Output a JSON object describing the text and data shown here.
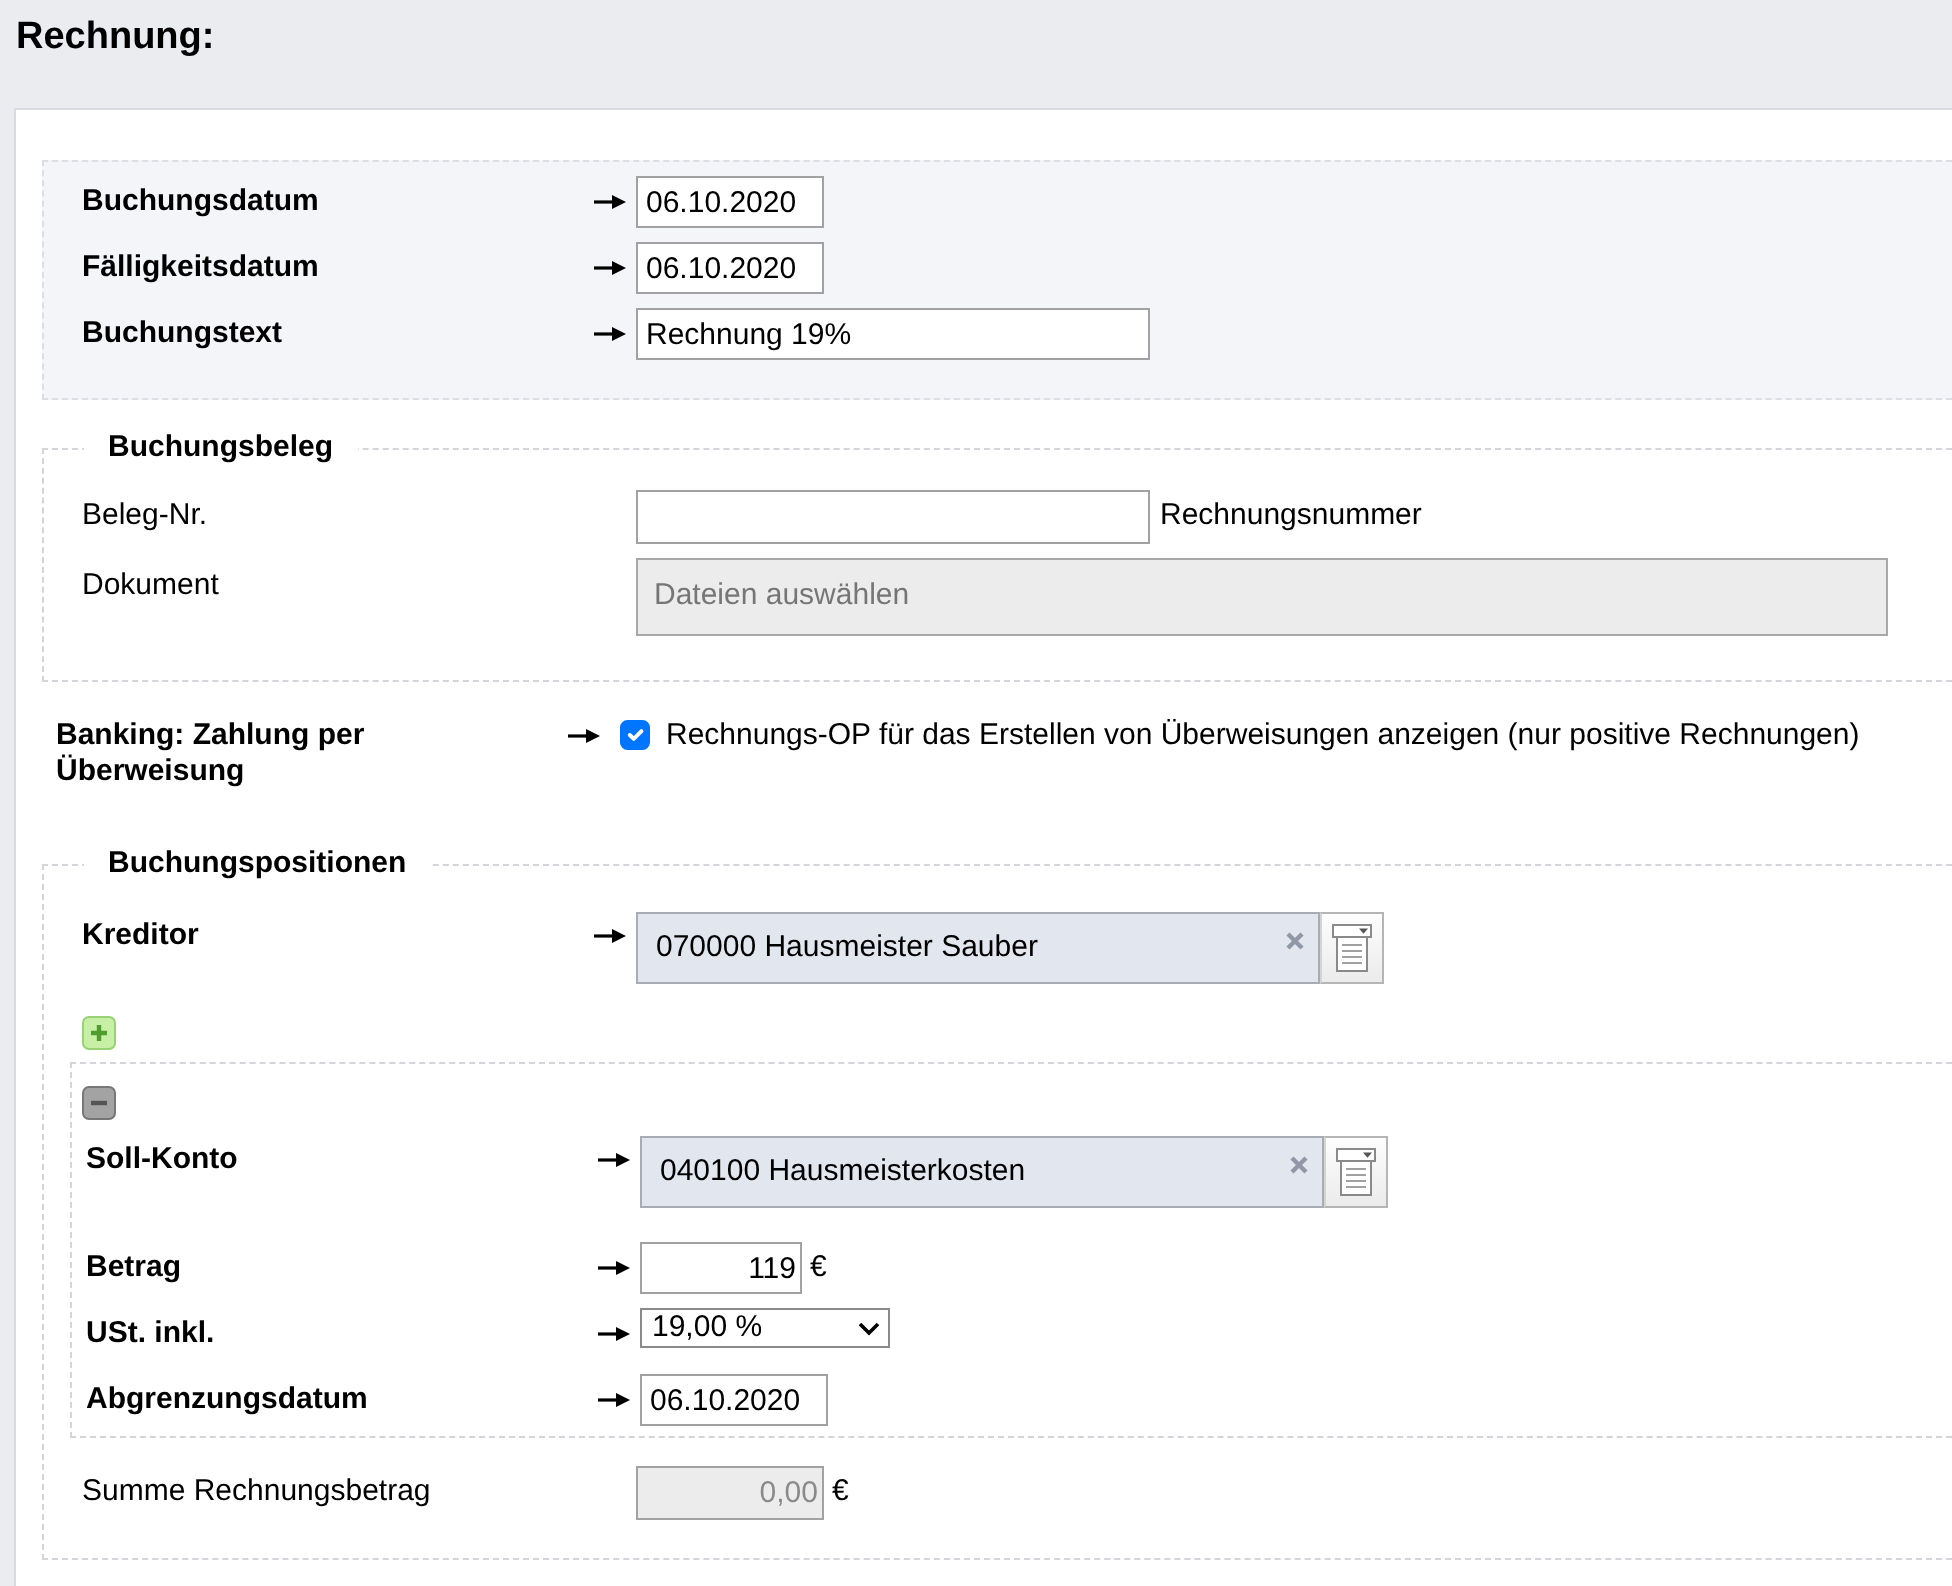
{
  "page": {
    "title": "Rechnung:"
  },
  "header_fields": [
    {
      "label": "Buchungsdatum",
      "value": "06.10.2020",
      "kind": "date",
      "required": true
    },
    {
      "label": "Fälligkeitsdatum",
      "value": "06.10.2020",
      "kind": "date",
      "required": true
    },
    {
      "label": "Buchungstext",
      "value": "Rechnung 19%",
      "kind": "text",
      "required": true
    }
  ],
  "buchungsbeleg": {
    "legend": "Buchungsbeleg",
    "beleg_nr": {
      "label": "Beleg-Nr.",
      "note": "Rechnungsnummer",
      "required": false
    },
    "dokument": {
      "label": "Dokument",
      "prompt": "Dateien auswählen",
      "required": false
    }
  },
  "banking": {
    "label": "Banking: Zahlung per Überweisung",
    "required": true,
    "checked": true,
    "text": "Rechnungs-OP für das Erstellen von Überweisungen anzeigen (nur positive Rechnungen)"
  },
  "buchungspositionen": {
    "legend": "Buchungspositionen",
    "kreditor": {
      "label": "Kreditor",
      "value": "070000 Hausmeister Sauber",
      "required": true
    },
    "positions": [
      {
        "soll_konto": {
          "label": "Soll-Konto",
          "value": "040100 Hausmeisterkosten",
          "required": true
        },
        "betrag": {
          "label": "Betrag",
          "value": "119",
          "unit": "€",
          "required": true
        },
        "ust": {
          "label": "USt. inkl.",
          "value": "19,00 %",
          "required": true
        },
        "abgrenzungsdatum": {
          "label": "Abgrenzungsdatum",
          "value": "06.10.2020",
          "required": true
        }
      }
    ],
    "summe": {
      "label": "Summe Rechnungsbetrag",
      "value": "0,00",
      "unit": "€",
      "required": false,
      "disabled": true
    }
  }
}
